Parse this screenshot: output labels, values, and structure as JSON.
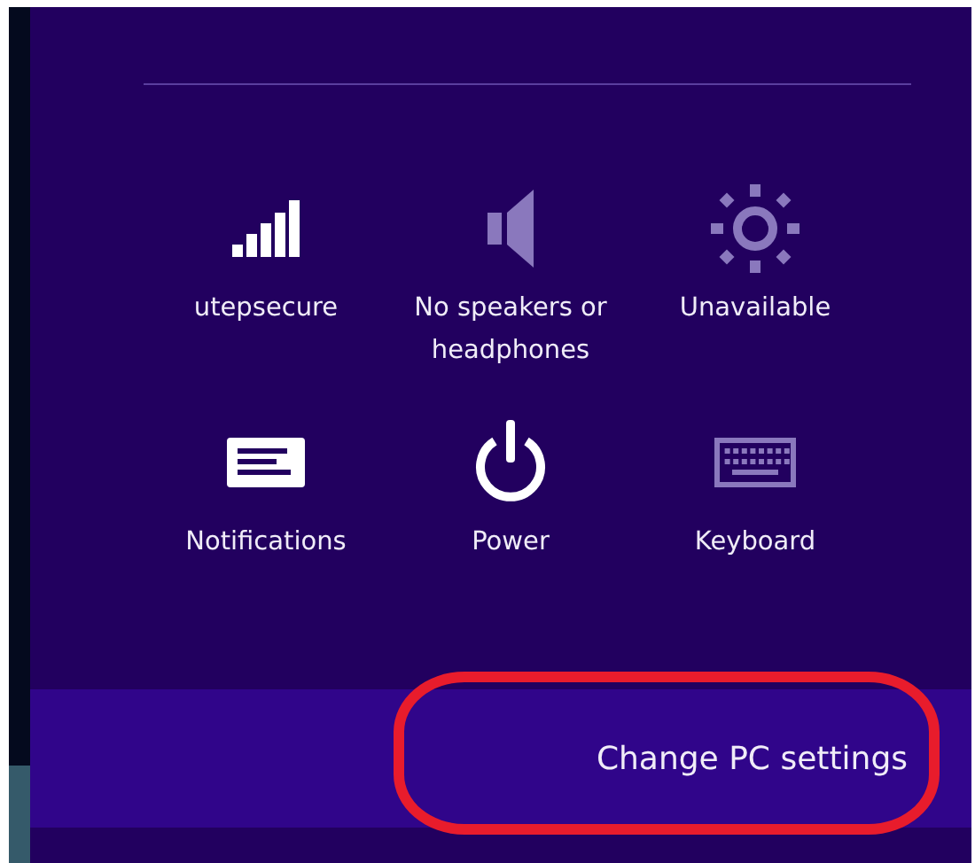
{
  "quick_settings": [
    {
      "kind": "network",
      "label": "utepsecure",
      "disabled": false
    },
    {
      "kind": "volume",
      "label": "No speakers or headphones",
      "disabled": true
    },
    {
      "kind": "brightness",
      "label": "Unavailable",
      "disabled": true
    },
    {
      "kind": "notifications",
      "label": "Notifications",
      "disabled": false
    },
    {
      "kind": "power",
      "label": "Power",
      "disabled": false
    },
    {
      "kind": "keyboard",
      "label": "Keyboard",
      "disabled": true
    }
  ],
  "settings_link": {
    "label": "Change PC settings",
    "highlighted": true
  }
}
